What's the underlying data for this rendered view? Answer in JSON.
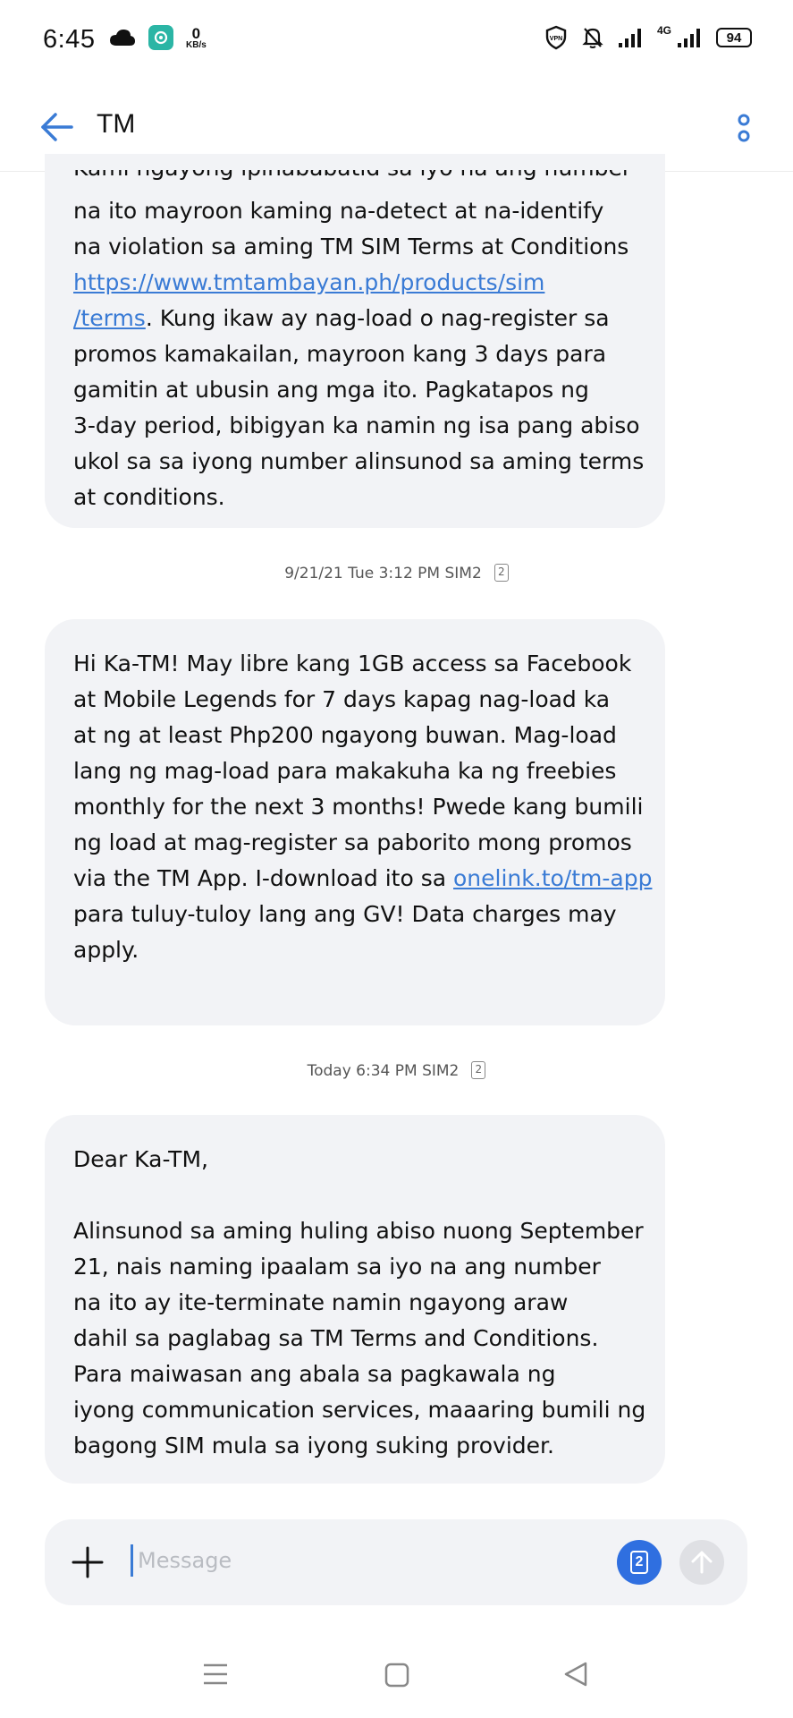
{
  "status_bar": {
    "time": "6:45",
    "net_speed_value": "0",
    "net_speed_unit": "KB/s",
    "network_type": "4G",
    "battery": "94",
    "icons": [
      "cloud-icon",
      "app-icon",
      "vpn-icon",
      "bell-off-icon",
      "signal-icon",
      "signal-icon",
      "battery-icon"
    ]
  },
  "app_bar": {
    "title": "TM"
  },
  "messages": [
    {
      "partial_top_line": "Kami ngayong ipinababatid sa iyo na ang number",
      "lines": [
        {
          "text": "na ito mayroon kaming na-detect at na-identify"
        },
        {
          "text": "na violation sa aming TM SIM Terms at Conditions"
        },
        {
          "link": "https://www.tmtambayan.ph/products/sim"
        },
        {
          "link": "/terms",
          "text": ". Kung ikaw ay nag-load o nag-register sa"
        },
        {
          "text": "promos kamakailan, mayroon kang 3 days para"
        },
        {
          "text": "gamitin at ubusin ang mga ito. Pagkatapos ng"
        },
        {
          "text": "3-day period, bibigyan ka namin ng isa pang abiso"
        },
        {
          "text": "ukol sa sa iyong number alinsunod sa aming terms"
        },
        {
          "text": "at conditions."
        }
      ]
    },
    {
      "timestamp": "9/21/21 Tue 3:12 PM  SIM2",
      "sim_badge": "2",
      "lines": [
        {
          "text": "Hi Ka-TM! May libre kang 1GB access sa Facebook"
        },
        {
          "text": "at Mobile Legends for 7 days kapag nag-load ka"
        },
        {
          "text": "at ng at least Php200 ngayong buwan. Mag-load"
        },
        {
          "text": "lang ng mag-load para makakuha ka ng freebies"
        },
        {
          "text": "monthly for the next 3 months! Pwede kang bumili"
        },
        {
          "text": "ng load at mag-register sa paborito mong promos"
        },
        {
          "text": "via the TM App. I-download ito sa ",
          "link": "onelink.to/tm-app"
        },
        {
          "text": "para tuluy-tuloy lang ang GV!  Data charges may"
        },
        {
          "text": "apply."
        }
      ]
    },
    {
      "timestamp": "Today 6:34 PM  SIM2",
      "sim_badge": "2",
      "lines": [
        {
          "text": "Dear Ka-TM,"
        },
        {
          "text": ""
        },
        {
          "text": "Alinsunod sa aming huling abiso nuong September"
        },
        {
          "text": "21, nais naming ipaalam sa iyo na ang number"
        },
        {
          "text": "na ito ay ite-terminate namin ngayong araw"
        },
        {
          "text": "dahil sa paglabag sa TM Terms and Conditions."
        },
        {
          "text": "Para maiwasan ang abala sa pagkawala ng"
        },
        {
          "text": "iyong communication services, maaaring bumili ng"
        },
        {
          "text": "bagong SIM mula sa iyong suking provider."
        }
      ]
    }
  ],
  "composer": {
    "placeholder": "Message",
    "value": "",
    "sim_badge": "2"
  },
  "colors": {
    "accent": "#2f6fe0",
    "link": "#3a7bd5",
    "bubble": "#f2f3f6"
  }
}
